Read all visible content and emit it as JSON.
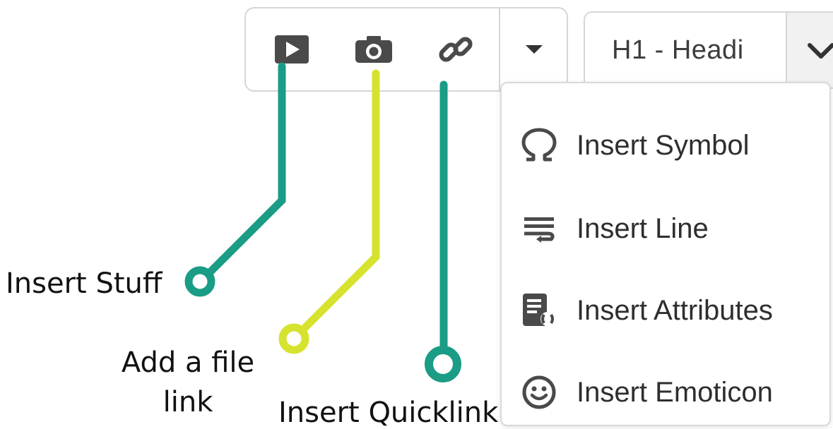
{
  "toolbar": {
    "buttons": [
      {
        "name": "insert-stuff",
        "icon": "play-video-icon"
      },
      {
        "name": "add-file-link",
        "icon": "camera-icon"
      },
      {
        "name": "insert-quicklink",
        "icon": "link-icon"
      },
      {
        "name": "more-dropdown",
        "icon": "caret-down-icon"
      }
    ],
    "icon_color": "#4a4a4a"
  },
  "style_select": {
    "value": "H1 - Headi",
    "icon": "chevron-down-icon"
  },
  "menu": {
    "items": [
      {
        "label": "Insert Symbol",
        "icon": "omega-icon"
      },
      {
        "label": "Insert Line",
        "icon": "line-wrap-icon"
      },
      {
        "label": "Insert Attributes",
        "icon": "attributes-icon"
      },
      {
        "label": "Insert Emoticon",
        "icon": "smiley-icon"
      }
    ]
  },
  "callouts": [
    {
      "label": "Insert Stuff",
      "color": "#1a9c86"
    },
    {
      "label": "Add a file\nlink",
      "color": "#d6e32e"
    },
    {
      "label": "Insert Quicklink",
      "color": "#1a9c86"
    }
  ]
}
